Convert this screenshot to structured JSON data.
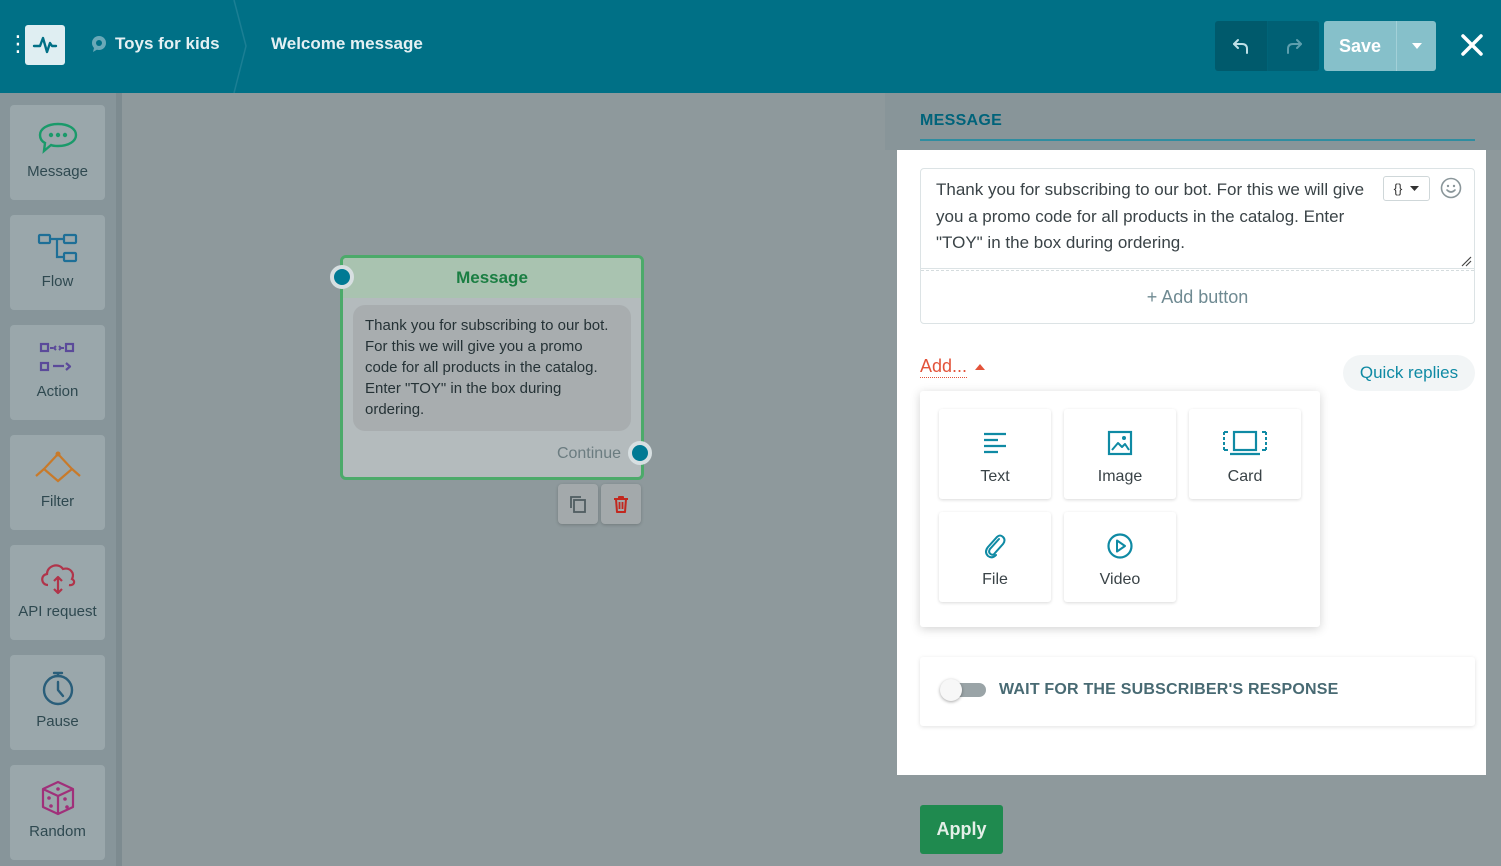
{
  "header": {
    "bot_name": "Toys for kids",
    "step_name": "Welcome message",
    "save_label": "Save"
  },
  "sidebar": {
    "items": [
      {
        "label": "Message",
        "icon": "chat-bubble-icon",
        "color": "#1a9a6a"
      },
      {
        "label": "Flow",
        "icon": "flow-icon",
        "color": "#1e6f97"
      },
      {
        "label": "Action",
        "icon": "action-icon",
        "color": "#5b4a9a"
      },
      {
        "label": "Filter",
        "icon": "filter-icon",
        "color": "#c87a2a"
      },
      {
        "label": "API request",
        "icon": "cloud-icon",
        "color": "#b0344a"
      },
      {
        "label": "Pause",
        "icon": "stopwatch-icon",
        "color": "#2a5e7a"
      },
      {
        "label": "Random",
        "icon": "dice-icon",
        "color": "#a0307a"
      }
    ]
  },
  "canvas": {
    "node": {
      "title": "Message",
      "text": "Thank you for subscribing to our bot. For this we will give you a promo code for all products in the catalog. Enter \"TOY\" in the box during ordering.",
      "continue_label": "Continue"
    }
  },
  "panel": {
    "title": "MESSAGE",
    "message_text": "Thank you for subscribing to our bot. For this we will give you a promo code for all products in the catalog. Enter \"TOY\" in the box during ordering.",
    "add_button_label": "+ Add button",
    "add_menu_label": "Add...",
    "quick_replies_label": "Quick replies",
    "add_options": [
      {
        "label": "Text",
        "icon": "text-lines-icon"
      },
      {
        "label": "Image",
        "icon": "image-icon"
      },
      {
        "label": "Card",
        "icon": "card-icon"
      },
      {
        "label": "File",
        "icon": "paperclip-icon"
      },
      {
        "label": "Video",
        "icon": "play-circle-icon"
      }
    ],
    "wait_label": "WAIT FOR THE SUBSCRIBER'S RESPONSE",
    "wait_enabled": false,
    "apply_label": "Apply"
  },
  "colors": {
    "header_bg": "#007086",
    "accent": "#0f8aa4",
    "apply_green": "#1f8a4f",
    "add_red": "#e3533a"
  }
}
